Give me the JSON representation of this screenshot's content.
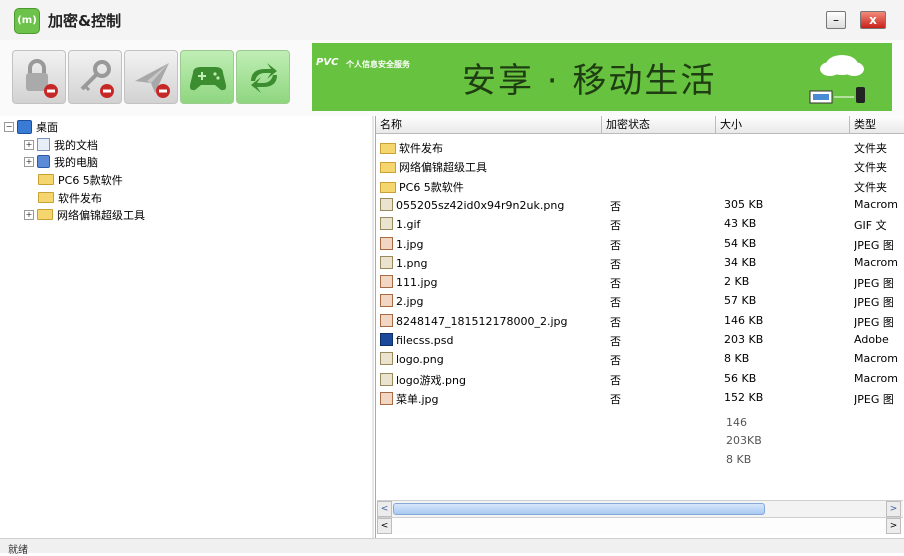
{
  "window": {
    "title": "加密&控制",
    "minimize_label": "–",
    "close_label": "x",
    "app_icon_text": "(m)"
  },
  "toolbar": {
    "buttons": [
      {
        "name": "lock-forbidden-icon",
        "enabled": false
      },
      {
        "name": "key-forbidden-icon",
        "enabled": false
      },
      {
        "name": "send-forbidden-icon",
        "enabled": false
      },
      {
        "name": "gamepad-icon",
        "enabled": true
      },
      {
        "name": "sync-icon",
        "enabled": true
      }
    ]
  },
  "banner": {
    "brand": "PVC",
    "brand_sub": "个人信息安全服务",
    "slogan": "安享 · 移动生活",
    "accent_color": "#67c23f"
  },
  "tree": {
    "root": "桌面",
    "items": [
      {
        "label": "我的文档",
        "icon": "document-folder-icon"
      },
      {
        "label": "我的电脑",
        "icon": "computer-icon"
      },
      {
        "label": "PC6 5款软件",
        "icon": "folder-icon"
      },
      {
        "label": "软件发布",
        "icon": "folder-icon"
      },
      {
        "label": "网络偏锦超级工具",
        "icon": "folder-icon"
      }
    ]
  },
  "list": {
    "columns": [
      "名称",
      "加密状态",
      "大小",
      "类型"
    ],
    "rows": [
      {
        "name": "软件发布",
        "status": "",
        "size": "",
        "type": "文件夹",
        "icon": "folder"
      },
      {
        "name": "网络偏锦超级工具",
        "status": "",
        "size": "",
        "type": "文件夹",
        "icon": "folder"
      },
      {
        "name": "PC6 5款软件",
        "status": "",
        "size": "",
        "type": "文件夹",
        "icon": "folder"
      },
      {
        "name": "055205sz42id0x94r9n2uk.png",
        "status": "否",
        "size": "305 KB",
        "type": "Macrom",
        "icon": "png"
      },
      {
        "name": "1.gif",
        "status": "否",
        "size": "43 KB",
        "type": "GIF 文",
        "icon": "png"
      },
      {
        "name": "1.jpg",
        "status": "否",
        "size": "54 KB",
        "type": "JPEG 图",
        "icon": "jpg"
      },
      {
        "name": "1.png",
        "status": "否",
        "size": "34 KB",
        "type": "Macrom",
        "icon": "png"
      },
      {
        "name": "111.jpg",
        "status": "否",
        "size": "2 KB",
        "type": "JPEG 图",
        "icon": "jpg"
      },
      {
        "name": "2.jpg",
        "status": "否",
        "size": "57 KB",
        "type": "JPEG 图",
        "icon": "jpg"
      },
      {
        "name": "8248147_181512178000_2.jpg",
        "status": "否",
        "size": "146 KB",
        "type": "JPEG 图",
        "icon": "jpg"
      },
      {
        "name": "filecss.psd",
        "status": "否",
        "size": "203 KB",
        "type": "Adobe",
        "icon": "psd"
      },
      {
        "name": "logo.png",
        "status": "否",
        "size": "8 KB",
        "type": "Macrom",
        "icon": "png"
      },
      {
        "name": "logo游戏.png",
        "status": "否",
        "size": "56 KB",
        "type": "Macrom",
        "icon": "png"
      },
      {
        "name": "菜单.jpg",
        "status": "否",
        "size": "152 KB",
        "type": "JPEG 图",
        "icon": "jpg"
      }
    ],
    "ghost_sizes": [
      "146",
      "203KB",
      "8 KB"
    ]
  },
  "scrollbar": {
    "left_arrow": "<",
    "right_arrow": ">"
  },
  "status": {
    "text": "就绪"
  }
}
